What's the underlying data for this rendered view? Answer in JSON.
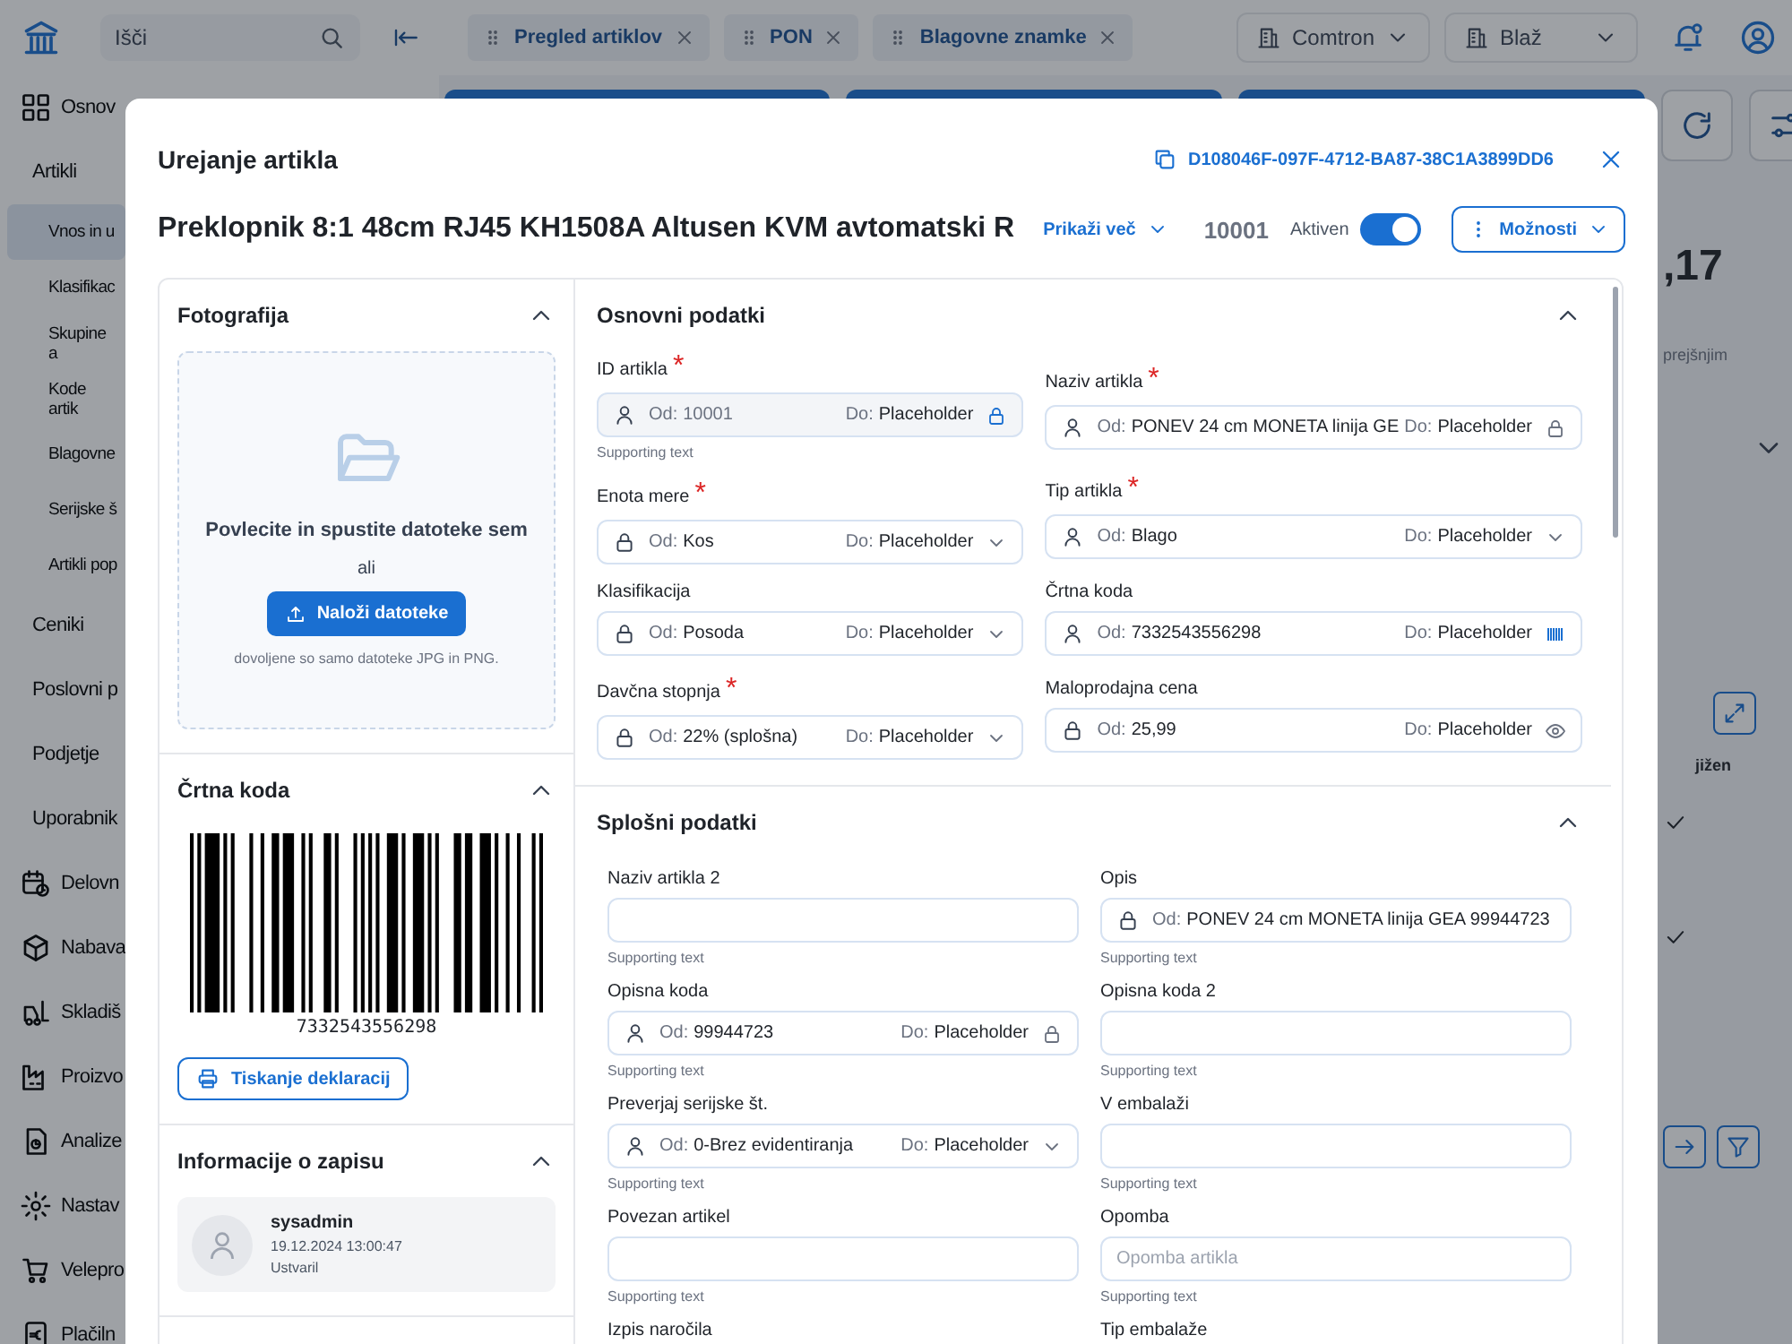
{
  "topbar": {
    "search": {
      "placeholder": "Išči"
    },
    "tabs": [
      {
        "label": "Pregled artiklov"
      },
      {
        "label": "PON"
      },
      {
        "label": "Blagovne znamke"
      }
    ],
    "company": "Comtron",
    "warehouse": "Blaž"
  },
  "sidebar": {
    "items": [
      {
        "kind": "module",
        "label": "Osnov"
      },
      {
        "kind": "section",
        "label": "Artikli"
      },
      {
        "kind": "page",
        "label": "Vnos in u",
        "selected": true
      },
      {
        "kind": "page",
        "label": "Klasifikac",
        "selected": false
      },
      {
        "kind": "page",
        "label": "Skupine a",
        "selected": false
      },
      {
        "kind": "page",
        "label": "Kode artik",
        "selected": false
      },
      {
        "kind": "page",
        "label": "Blagovne",
        "selected": false
      },
      {
        "kind": "page",
        "label": "Serijske š",
        "selected": false
      },
      {
        "kind": "page",
        "label": "Artikli pop",
        "selected": false
      },
      {
        "kind": "section",
        "label": "Ceniki"
      },
      {
        "kind": "section",
        "label": "Poslovni p"
      },
      {
        "kind": "section",
        "label": "Podjetje"
      },
      {
        "kind": "section",
        "label": "Uporabnik"
      },
      {
        "kind": "module",
        "label": "Delovn"
      },
      {
        "kind": "module",
        "label": "Nabava"
      },
      {
        "kind": "module",
        "label": "Skladiš"
      },
      {
        "kind": "module",
        "label": "Proizvo"
      },
      {
        "kind": "module",
        "label": "Analize"
      },
      {
        "kind": "module",
        "label": "Nastav"
      },
      {
        "kind": "module",
        "label": "Velepro"
      },
      {
        "kind": "module",
        "label": "Plačiln"
      }
    ]
  },
  "background": {
    "value_fragment": ",17",
    "note_fragment": "prejšnjim",
    "column_fragment": "jižen"
  },
  "dialog": {
    "title": "Urejanje artikla",
    "guid": "D108046F-097F-4712-BA87-38C1A3899DD6",
    "article_name": "Preklopnik 8:1 48cm RJ45 KH1508A Altusen KVM avtomatski R",
    "show_more": "Prikaži več",
    "article_id": "10001",
    "active_label": "Aktiven",
    "active": true,
    "options_button": "Možnosti",
    "photo": {
      "title": "Fotografija",
      "expanded": true,
      "drop_text": "Povlecite in spustite datoteke sem",
      "or": "ali",
      "upload_button": "Naloži datoteke",
      "hint": "dovoljene so samo datoteke JPG in PNG."
    },
    "barcode": {
      "title": "Črtna koda",
      "expanded": true,
      "value": "7332543556298",
      "print_button": "Tiskanje deklaracij"
    },
    "record_info": {
      "title": "Informacije o zapisu",
      "expanded": true,
      "user": "sysadmin",
      "timestamp": "19.12.2024 13:00:47",
      "action": "Ustvaril"
    },
    "sections": [
      {
        "title": "Osnovni podatki",
        "expanded": true,
        "columns": [
          [
            {
              "kind": "fixed",
              "label": "ID artikla",
              "required_mark": "*",
              "locked": false,
              "from_label": "Od:",
              "value": "10001",
              "to_label": "Do:",
              "to_value": "Placeholder",
              "disabled": true,
              "supporting": "Supporting text"
            },
            {
              "kind": "select",
              "label": "Enota mere",
              "required_mark": "*",
              "locked": true,
              "from_label": "Od:",
              "value": "Kos",
              "to_label": "Do:",
              "to_value": "Placeholder",
              "disabled": false
            },
            {
              "kind": "select",
              "label": "Klasifikacija",
              "locked": true,
              "from_label": "Od:",
              "value": "Posoda",
              "to_label": "Do:",
              "to_value": "Placeholder",
              "disabled": false
            },
            {
              "kind": "select",
              "label": "Davčna stopnja",
              "required_mark": "*",
              "locked": true,
              "from_label": "Od:",
              "value": "22% (splošna)",
              "to_label": "Do:",
              "to_value": "Placeholder",
              "disabled": false
            }
          ],
          [
            {
              "kind": "fixed",
              "label": "Naziv artikla",
              "required_mark": "*",
              "locked": false,
              "from_label": "Od:",
              "value": "PONEV 24 cm MONETA linija GE",
              "to_label": "Do:",
              "to_value": "Placeholder",
              "disabled": false
            },
            {
              "kind": "select",
              "label": "Tip artikla",
              "required_mark": "*",
              "locked": false,
              "from_label": "Od:",
              "value": "Blago",
              "to_label": "Do:",
              "to_value": "Placeholder",
              "disabled": false
            },
            {
              "kind": "barcode",
              "label": "Črtna koda",
              "locked": false,
              "from_label": "Od:",
              "value": "7332543556298",
              "to_label": "Do:",
              "to_value": "Placeholder",
              "disabled": false
            },
            {
              "kind": "view",
              "label": "Maloprodajna cena",
              "locked": true,
              "from_label": "Od:",
              "value": "25,99",
              "to_label": "Do:",
              "to_value": "Placeholder",
              "disabled": false
            }
          ]
        ]
      },
      {
        "title": "Splošni podatki",
        "expanded": true,
        "fields": [
          {
            "kind": "text",
            "label": "Naziv artikla 2",
            "supporting": "Supporting text"
          },
          {
            "kind": "plain",
            "label": "Opis",
            "locked": true,
            "from_label": "Od:",
            "value": "PONEV 24 cm MONETA linija GEA 99944723",
            "disabled": false,
            "supporting": "Supporting text"
          },
          {
            "kind": "fixed",
            "label": "Opisna koda",
            "locked": false,
            "from_label": "Od:",
            "value": "99944723",
            "to_label": "Do:",
            "to_value": "Placeholder",
            "disabled": false,
            "supporting": "Supporting text"
          },
          {
            "kind": "text",
            "label": "Opisna koda 2",
            "supporting": "Supporting text"
          },
          {
            "kind": "select",
            "label": "Preverjaj serijske št.",
            "locked": false,
            "from_label": "Od:",
            "value": "0-Brez evidentiranja",
            "to_label": "Do:",
            "to_value": "Placeholder",
            "disabled": false,
            "supporting": "Supporting text"
          },
          {
            "kind": "text",
            "label": "V embalaži",
            "supporting": "Supporting text"
          },
          {
            "kind": "text",
            "label": "Povezan artikel",
            "supporting": "Supporting text"
          },
          {
            "kind": "text",
            "label": "Opomba",
            "placeholder": "Opomba artikla",
            "supporting": "Supporting text"
          },
          {
            "kind": "label",
            "label": "Izpis naročila"
          },
          {
            "kind": "label",
            "label": "Tip embalaže"
          }
        ]
      }
    ]
  }
}
